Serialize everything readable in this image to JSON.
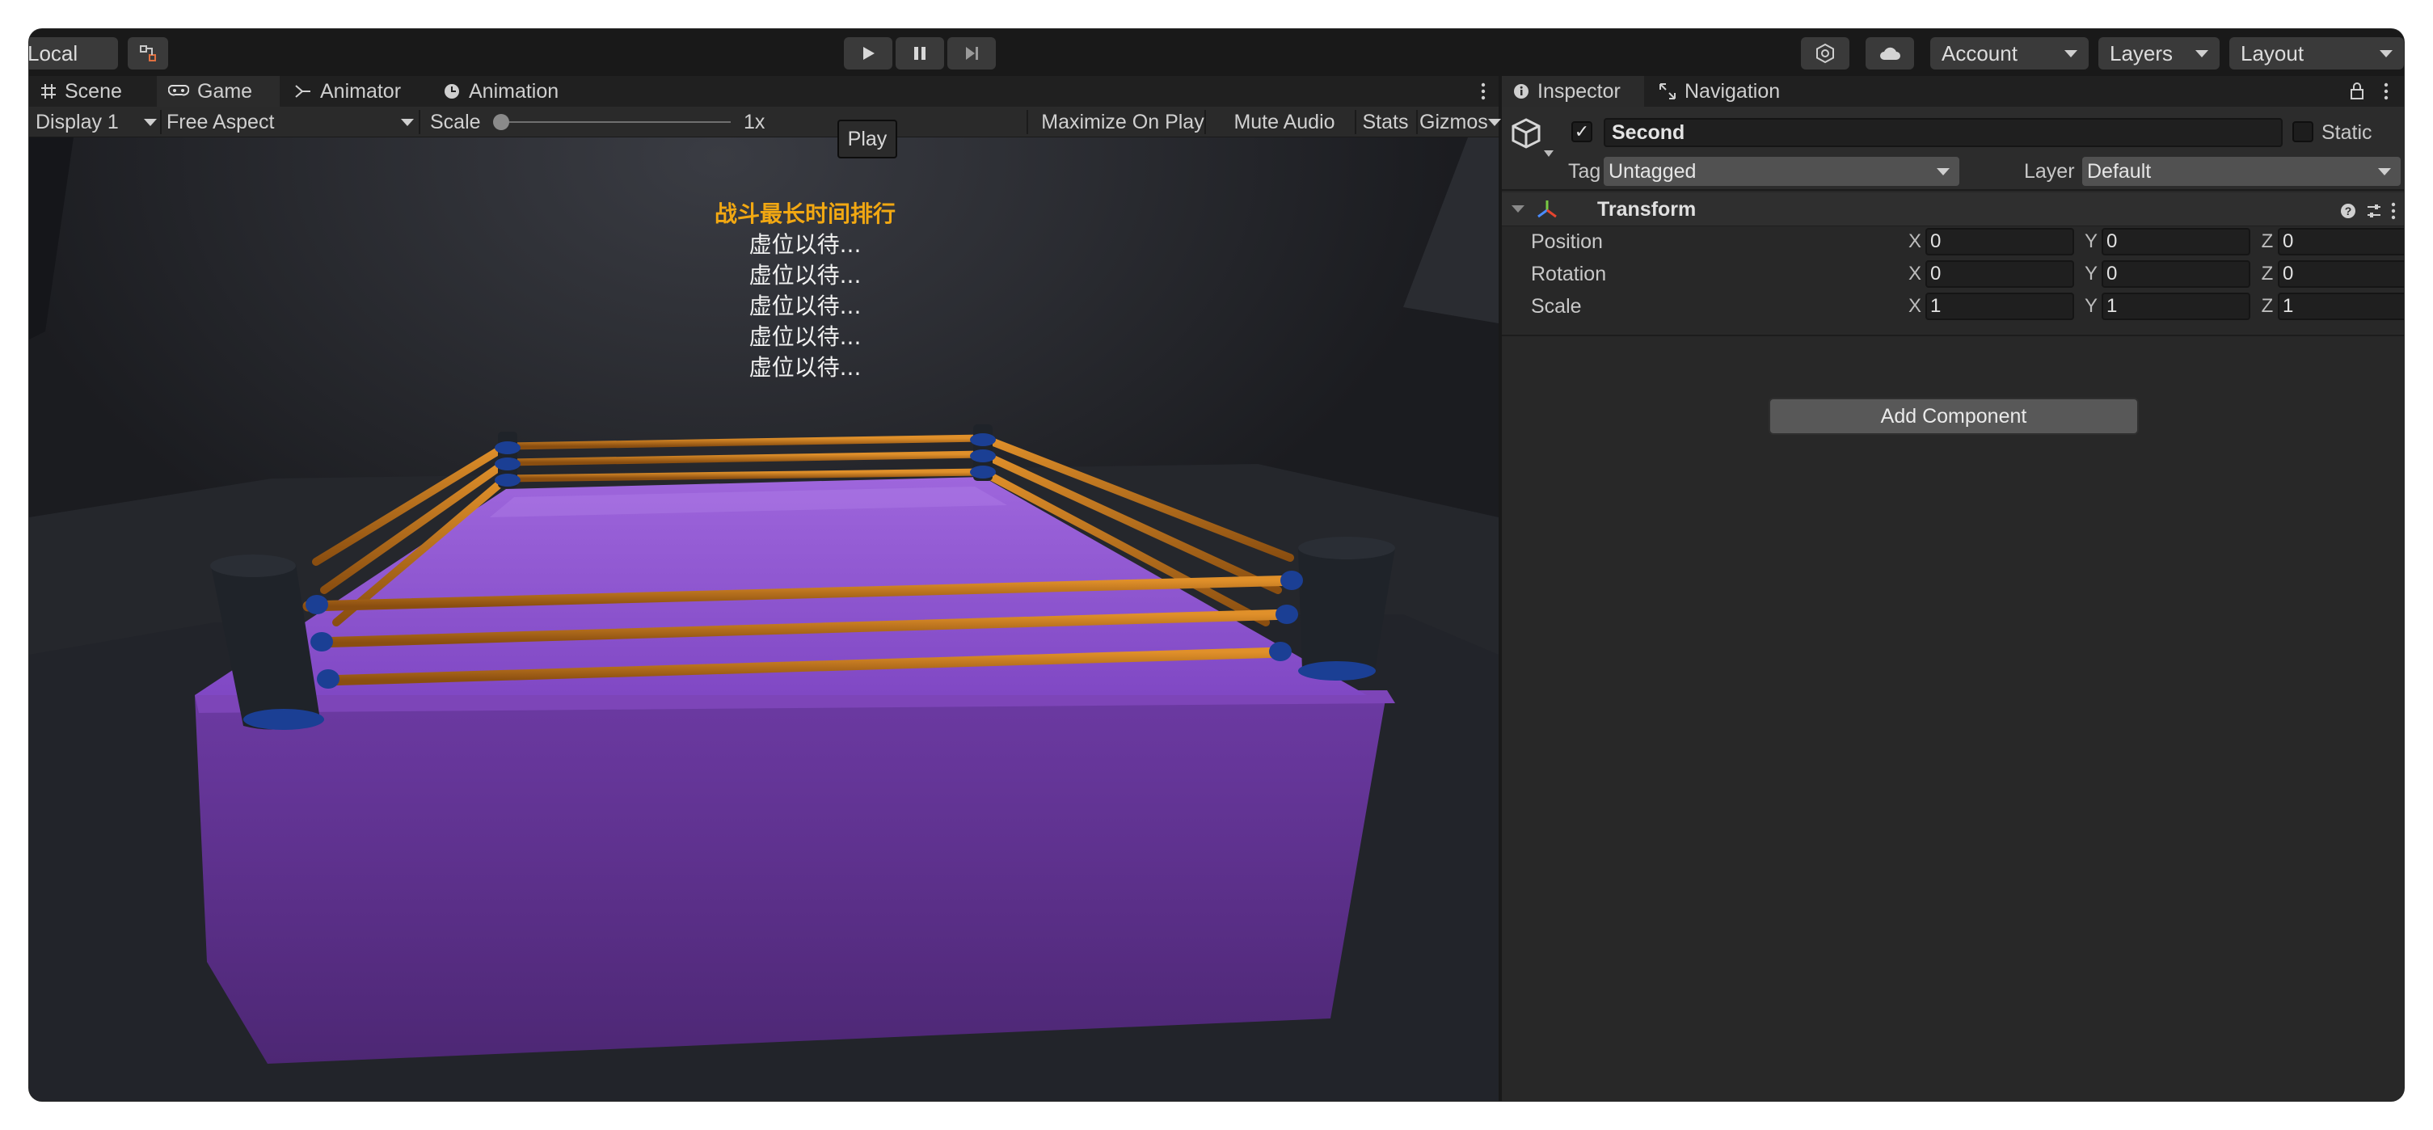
{
  "toolbar": {
    "local_label": "Local",
    "account_label": "Account",
    "layers_label": "Layers",
    "layout_label": "Layout",
    "play_tooltip": "Play"
  },
  "left_tabs": [
    "Scene",
    "Game",
    "Animator",
    "Animation"
  ],
  "game_bar": {
    "display": "Display 1",
    "aspect": "Free Aspect",
    "scale_label": "Scale",
    "scale_value": "1x",
    "maximize": "Maximize On Play",
    "mute": "Mute Audio",
    "stats": "Stats",
    "gizmos": "Gizmos"
  },
  "leaderboard": {
    "title": "战斗最长时间排行",
    "rows": [
      "虚位以待...",
      "虚位以待...",
      "虚位以待...",
      "虚位以待...",
      "虚位以待..."
    ]
  },
  "right_tabs": [
    "Inspector",
    "Navigation"
  ],
  "inspector": {
    "object_name": "Second",
    "static_label": "Static",
    "tag_label": "Tag",
    "tag_value": "Untagged",
    "layer_label": "Layer",
    "layer_value": "Default",
    "component_title": "Transform",
    "rows": [
      {
        "label": "Position",
        "x": "0",
        "y": "0",
        "z": "0"
      },
      {
        "label": "Rotation",
        "x": "0",
        "y": "0",
        "z": "0"
      },
      {
        "label": "Scale",
        "x": "1",
        "y": "1",
        "z": "1"
      }
    ],
    "axis_x": "X",
    "axis_y": "Y",
    "axis_z": "Z",
    "add_component": "Add Component"
  },
  "colors": {
    "ring_mat": "#8a52c8",
    "ropes": "#c7761e",
    "corner_posts": "#1f2329",
    "turnbuckles": "#1b3f94",
    "leaderboard_title": "#f2a812"
  }
}
